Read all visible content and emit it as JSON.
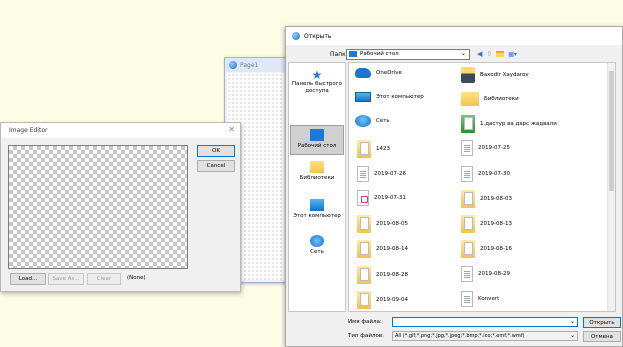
{
  "page1": {
    "title": "Page1"
  },
  "image_editor": {
    "title": "Image Editor",
    "ok_label": "OK",
    "cancel_label": "Cancel",
    "load_label": "Load...",
    "save_as_label": "Save As...",
    "clear_label": "Clear",
    "none_label": "(None)"
  },
  "open_dialog": {
    "title": "Открыть",
    "folder_label": "Папка:",
    "folder_value": "Рабочий стол",
    "places": [
      {
        "label": "Панель быстрого доступа",
        "icon": "star-icon"
      },
      {
        "label": "Рабочий стол",
        "icon": "desktop-icon"
      },
      {
        "label": "Библиотеки",
        "icon": "libraries-icon"
      },
      {
        "label": "Этот компьютер",
        "icon": "computer-icon"
      },
      {
        "label": "Сеть",
        "icon": "network-icon"
      }
    ],
    "files_left": [
      {
        "name": "OneDrive",
        "icon": "onedrive-icon"
      },
      {
        "name": "Этот компьютер",
        "icon": "computer-icon"
      },
      {
        "name": "Сеть",
        "icon": "network-icon"
      },
      {
        "name": "1423",
        "icon": "folder-icon"
      },
      {
        "name": "2019-07-26",
        "icon": "document-icon"
      },
      {
        "name": "2019-07-31",
        "icon": "document-icon"
      },
      {
        "name": "2019-08-05",
        "icon": "folder-icon"
      },
      {
        "name": "2019-08-14",
        "icon": "folder-icon"
      },
      {
        "name": "2019-08-28",
        "icon": "folder-icon"
      },
      {
        "name": "2019-09-04",
        "icon": "folder-icon"
      }
    ],
    "files_right": [
      {
        "name": "Baxodir Xaydarov",
        "icon": "user-folder-icon"
      },
      {
        "name": "Библиотеки",
        "icon": "libraries-icon"
      },
      {
        "name": "1.дастур ва дарс жадвали",
        "icon": "document-icon"
      },
      {
        "name": "2019-07-25",
        "icon": "document-icon"
      },
      {
        "name": "2019-07-30",
        "icon": "document-icon"
      },
      {
        "name": "2019-08-03",
        "icon": "folder-icon"
      },
      {
        "name": "2019-08-13",
        "icon": "folder-icon"
      },
      {
        "name": "2019-08-16",
        "icon": "folder-icon"
      },
      {
        "name": "2019-08-29",
        "icon": "document-icon"
      },
      {
        "name": "Konvert",
        "icon": "document-icon"
      }
    ],
    "filename_label": "Имя файла:",
    "filename_value": "",
    "filetype_label": "Тип файлов:",
    "filetype_value": "All (*.gif;*.png;*.jpg;*.jpeg;*.bmp;*.ico;*.emf;*.wmf)",
    "open_label": "Открыть",
    "cancel_label": "Отмена"
  }
}
